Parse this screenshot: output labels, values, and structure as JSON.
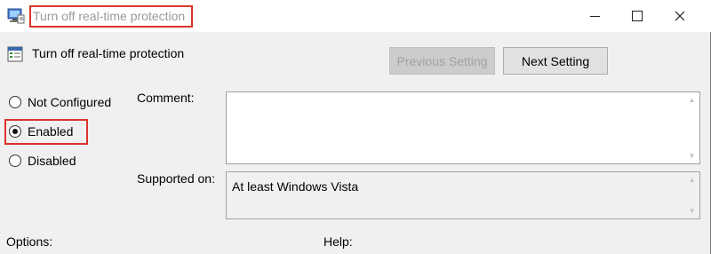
{
  "window": {
    "title": "Turn off real-time protection"
  },
  "policy": {
    "title": "Turn off real-time protection"
  },
  "buttons": {
    "previous_setting": "Previous Setting",
    "next_setting": "Next Setting"
  },
  "state": {
    "options": [
      {
        "label": "Not Configured",
        "checked": false
      },
      {
        "label": "Enabled",
        "checked": true
      },
      {
        "label": "Disabled",
        "checked": false
      }
    ]
  },
  "fields": {
    "comment_label": "Comment:",
    "comment_value": "",
    "supported_label": "Supported on:",
    "supported_value": "At least Windows Vista"
  },
  "sections": {
    "options_label": "Options:",
    "help_label": "Help:"
  },
  "colors": {
    "highlight": "#d9342b",
    "window_bg": "#f0f0f0"
  },
  "icons": {
    "app": "policy-editor-icon",
    "policy": "policy-setting-icon",
    "minimize": "minimize-icon",
    "maximize": "maximize-icon",
    "close": "close-icon"
  }
}
